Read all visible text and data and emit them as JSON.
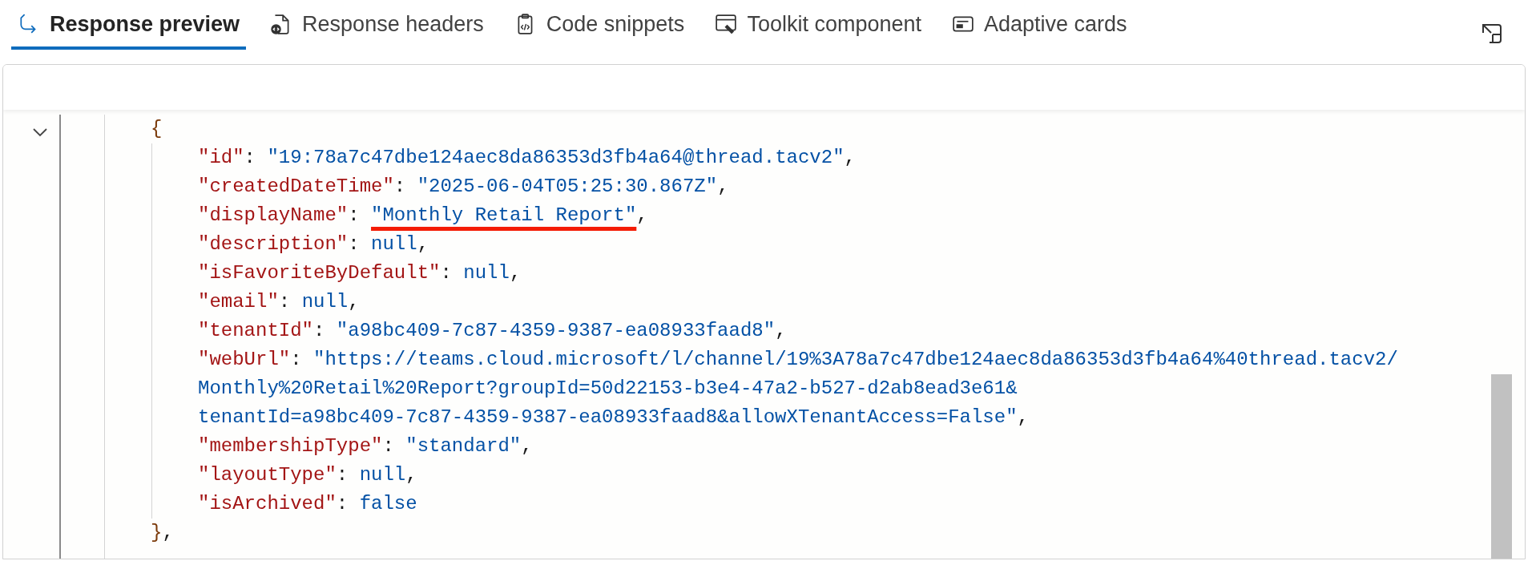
{
  "tabs": [
    {
      "label": "Response preview",
      "selected": true
    },
    {
      "label": "Response headers",
      "selected": false
    },
    {
      "label": "Code snippets",
      "selected": false
    },
    {
      "label": "Toolkit component",
      "selected": false
    },
    {
      "label": "Adaptive cards",
      "selected": false
    }
  ],
  "viewer": {
    "expanded": true,
    "open_brace": "{",
    "close_brace": "}",
    "close_comma": ",",
    "properties": [
      {
        "key": "\"id\"",
        "colon": ":",
        "value_lines": [
          "\"19:78a7c47dbe124aec8da86353d3fb4a64@thread.tacv2\""
        ],
        "comma": ",",
        "underlined": false
      },
      {
        "key": "\"createdDateTime\"",
        "colon": ":",
        "value_lines": [
          "\"2025-06-04T05:25:30.867Z\""
        ],
        "comma": ",",
        "underlined": false
      },
      {
        "key": "\"displayName\"",
        "colon": ":",
        "value_lines": [
          "\"Monthly Retail Report\""
        ],
        "comma": ",",
        "underlined": true
      },
      {
        "key": "\"description\"",
        "colon": ":",
        "value_lines": [
          "null"
        ],
        "comma": ",",
        "underlined": false
      },
      {
        "key": "\"isFavoriteByDefault\"",
        "colon": ":",
        "value_lines": [
          "null"
        ],
        "comma": ",",
        "underlined": false
      },
      {
        "key": "\"email\"",
        "colon": ":",
        "value_lines": [
          "null"
        ],
        "comma": ",",
        "underlined": false
      },
      {
        "key": "\"tenantId\"",
        "colon": ":",
        "value_lines": [
          "\"a98bc409-7c87-4359-9387-ea08933faad8\""
        ],
        "comma": ",",
        "underlined": false
      },
      {
        "key": "\"webUrl\"",
        "colon": ":",
        "value_lines": [
          "\"https://teams.cloud.microsoft/l/channel/19%3A78a7c47dbe124aec8da86353d3fb4a64%40thread.tacv2/",
          "Monthly%20Retail%20Report?groupId=50d22153-b3e4-47a2-b527-d2ab8ead3e61&",
          "tenantId=a98bc409-7c87-4359-9387-ea08933faad8&allowXTenantAccess=False\""
        ],
        "comma": ",",
        "underlined": false
      },
      {
        "key": "\"membershipType\"",
        "colon": ":",
        "value_lines": [
          "\"standard\""
        ],
        "comma": ",",
        "underlined": false
      },
      {
        "key": "\"layoutType\"",
        "colon": ":",
        "value_lines": [
          "null"
        ],
        "comma": ",",
        "underlined": false
      },
      {
        "key": "\"isArchived\"",
        "colon": ":",
        "value_lines": [
          "false"
        ],
        "underlined": false
      }
    ]
  }
}
